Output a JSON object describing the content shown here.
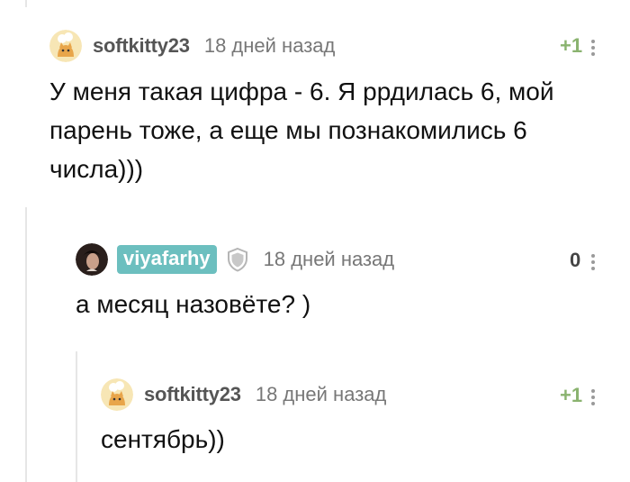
{
  "comments": [
    {
      "username": "softkitty23",
      "time": "18 дней назад",
      "score": "+1",
      "text": [
        "У меня такая цифра - 6. Я ррдилась 6, мой",
        "парень тоже, а еще мы познакомились 6",
        "числа)))"
      ]
    },
    {
      "username": "viyafarhy",
      "time": "18 дней назад",
      "score": "0",
      "text": [
        "а месяц назовёте? )"
      ]
    },
    {
      "username": "softkitty23",
      "time": "18 дней назад",
      "score": "+1",
      "text": [
        "сентябрь))"
      ]
    }
  ],
  "colors": {
    "badge": "#6cbfbf",
    "score_positive": "#8ab36f",
    "thread_line": "#e6e6e6"
  },
  "icons": {
    "avatar_softkitty": "cat-avatar-icon",
    "shield": "shield-icon",
    "more": "more-vertical-icon"
  }
}
